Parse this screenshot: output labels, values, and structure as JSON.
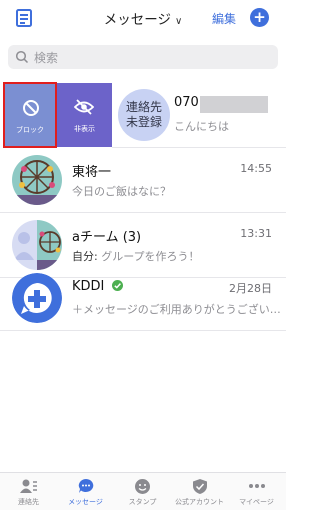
{
  "header": {
    "title": "メッセージ",
    "edit_label": "編集",
    "plus_label": "+"
  },
  "search": {
    "placeholder": "検索"
  },
  "swipe": {
    "block_label": "ブロック",
    "hide_label": "非表示"
  },
  "conversations": [
    {
      "name": "070",
      "message": "こんにちは",
      "time": "",
      "avatar_text": "連絡先\n未登録"
    },
    {
      "name": "東将一",
      "message": "今日のご飯はなに？",
      "time": "14:55"
    },
    {
      "name": "aチーム (3)",
      "message_prefix": "自分:",
      "message": "グループを作ろう！",
      "time": "13:31"
    },
    {
      "name": "KDDI",
      "message": "＋メッセージのご利用ありがとうござい…",
      "time": "2月28日",
      "verified": true
    }
  ],
  "tabs": [
    {
      "label": "連絡先",
      "icon": "contacts-icon"
    },
    {
      "label": "メッセージ",
      "icon": "message-icon",
      "active": true
    },
    {
      "label": "スタンプ",
      "icon": "smiley-icon"
    },
    {
      "label": "公式アカウント",
      "icon": "shield-check-icon"
    },
    {
      "label": "マイページ",
      "icon": "more-dots-icon"
    }
  ],
  "colors": {
    "accent": "#3f6fdc",
    "block_bg": "#7b8fd2",
    "hide_bg": "#6c63c9",
    "highlight_border": "#e01e1e"
  }
}
